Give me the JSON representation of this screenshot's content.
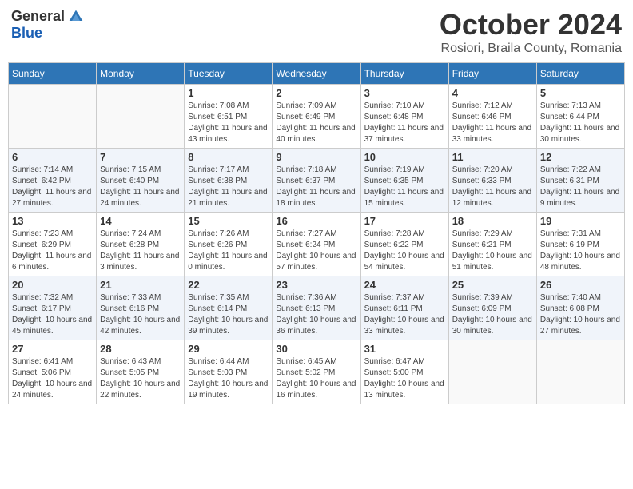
{
  "header": {
    "logo": {
      "general": "General",
      "blue": "Blue"
    },
    "title": "October 2024",
    "location": "Rosiori, Braila County, Romania"
  },
  "days_of_week": [
    "Sunday",
    "Monday",
    "Tuesday",
    "Wednesday",
    "Thursday",
    "Friday",
    "Saturday"
  ],
  "weeks": [
    [
      {
        "day": "",
        "info": ""
      },
      {
        "day": "",
        "info": ""
      },
      {
        "day": "1",
        "info": "Sunrise: 7:08 AM\nSunset: 6:51 PM\nDaylight: 11 hours and 43 minutes."
      },
      {
        "day": "2",
        "info": "Sunrise: 7:09 AM\nSunset: 6:49 PM\nDaylight: 11 hours and 40 minutes."
      },
      {
        "day": "3",
        "info": "Sunrise: 7:10 AM\nSunset: 6:48 PM\nDaylight: 11 hours and 37 minutes."
      },
      {
        "day": "4",
        "info": "Sunrise: 7:12 AM\nSunset: 6:46 PM\nDaylight: 11 hours and 33 minutes."
      },
      {
        "day": "5",
        "info": "Sunrise: 7:13 AM\nSunset: 6:44 PM\nDaylight: 11 hours and 30 minutes."
      }
    ],
    [
      {
        "day": "6",
        "info": "Sunrise: 7:14 AM\nSunset: 6:42 PM\nDaylight: 11 hours and 27 minutes."
      },
      {
        "day": "7",
        "info": "Sunrise: 7:15 AM\nSunset: 6:40 PM\nDaylight: 11 hours and 24 minutes."
      },
      {
        "day": "8",
        "info": "Sunrise: 7:17 AM\nSunset: 6:38 PM\nDaylight: 11 hours and 21 minutes."
      },
      {
        "day": "9",
        "info": "Sunrise: 7:18 AM\nSunset: 6:37 PM\nDaylight: 11 hours and 18 minutes."
      },
      {
        "day": "10",
        "info": "Sunrise: 7:19 AM\nSunset: 6:35 PM\nDaylight: 11 hours and 15 minutes."
      },
      {
        "day": "11",
        "info": "Sunrise: 7:20 AM\nSunset: 6:33 PM\nDaylight: 11 hours and 12 minutes."
      },
      {
        "day": "12",
        "info": "Sunrise: 7:22 AM\nSunset: 6:31 PM\nDaylight: 11 hours and 9 minutes."
      }
    ],
    [
      {
        "day": "13",
        "info": "Sunrise: 7:23 AM\nSunset: 6:29 PM\nDaylight: 11 hours and 6 minutes."
      },
      {
        "day": "14",
        "info": "Sunrise: 7:24 AM\nSunset: 6:28 PM\nDaylight: 11 hours and 3 minutes."
      },
      {
        "day": "15",
        "info": "Sunrise: 7:26 AM\nSunset: 6:26 PM\nDaylight: 11 hours and 0 minutes."
      },
      {
        "day": "16",
        "info": "Sunrise: 7:27 AM\nSunset: 6:24 PM\nDaylight: 10 hours and 57 minutes."
      },
      {
        "day": "17",
        "info": "Sunrise: 7:28 AM\nSunset: 6:22 PM\nDaylight: 10 hours and 54 minutes."
      },
      {
        "day": "18",
        "info": "Sunrise: 7:29 AM\nSunset: 6:21 PM\nDaylight: 10 hours and 51 minutes."
      },
      {
        "day": "19",
        "info": "Sunrise: 7:31 AM\nSunset: 6:19 PM\nDaylight: 10 hours and 48 minutes."
      }
    ],
    [
      {
        "day": "20",
        "info": "Sunrise: 7:32 AM\nSunset: 6:17 PM\nDaylight: 10 hours and 45 minutes."
      },
      {
        "day": "21",
        "info": "Sunrise: 7:33 AM\nSunset: 6:16 PM\nDaylight: 10 hours and 42 minutes."
      },
      {
        "day": "22",
        "info": "Sunrise: 7:35 AM\nSunset: 6:14 PM\nDaylight: 10 hours and 39 minutes."
      },
      {
        "day": "23",
        "info": "Sunrise: 7:36 AM\nSunset: 6:13 PM\nDaylight: 10 hours and 36 minutes."
      },
      {
        "day": "24",
        "info": "Sunrise: 7:37 AM\nSunset: 6:11 PM\nDaylight: 10 hours and 33 minutes."
      },
      {
        "day": "25",
        "info": "Sunrise: 7:39 AM\nSunset: 6:09 PM\nDaylight: 10 hours and 30 minutes."
      },
      {
        "day": "26",
        "info": "Sunrise: 7:40 AM\nSunset: 6:08 PM\nDaylight: 10 hours and 27 minutes."
      }
    ],
    [
      {
        "day": "27",
        "info": "Sunrise: 6:41 AM\nSunset: 5:06 PM\nDaylight: 10 hours and 24 minutes."
      },
      {
        "day": "28",
        "info": "Sunrise: 6:43 AM\nSunset: 5:05 PM\nDaylight: 10 hours and 22 minutes."
      },
      {
        "day": "29",
        "info": "Sunrise: 6:44 AM\nSunset: 5:03 PM\nDaylight: 10 hours and 19 minutes."
      },
      {
        "day": "30",
        "info": "Sunrise: 6:45 AM\nSunset: 5:02 PM\nDaylight: 10 hours and 16 minutes."
      },
      {
        "day": "31",
        "info": "Sunrise: 6:47 AM\nSunset: 5:00 PM\nDaylight: 10 hours and 13 minutes."
      },
      {
        "day": "",
        "info": ""
      },
      {
        "day": "",
        "info": ""
      }
    ]
  ]
}
